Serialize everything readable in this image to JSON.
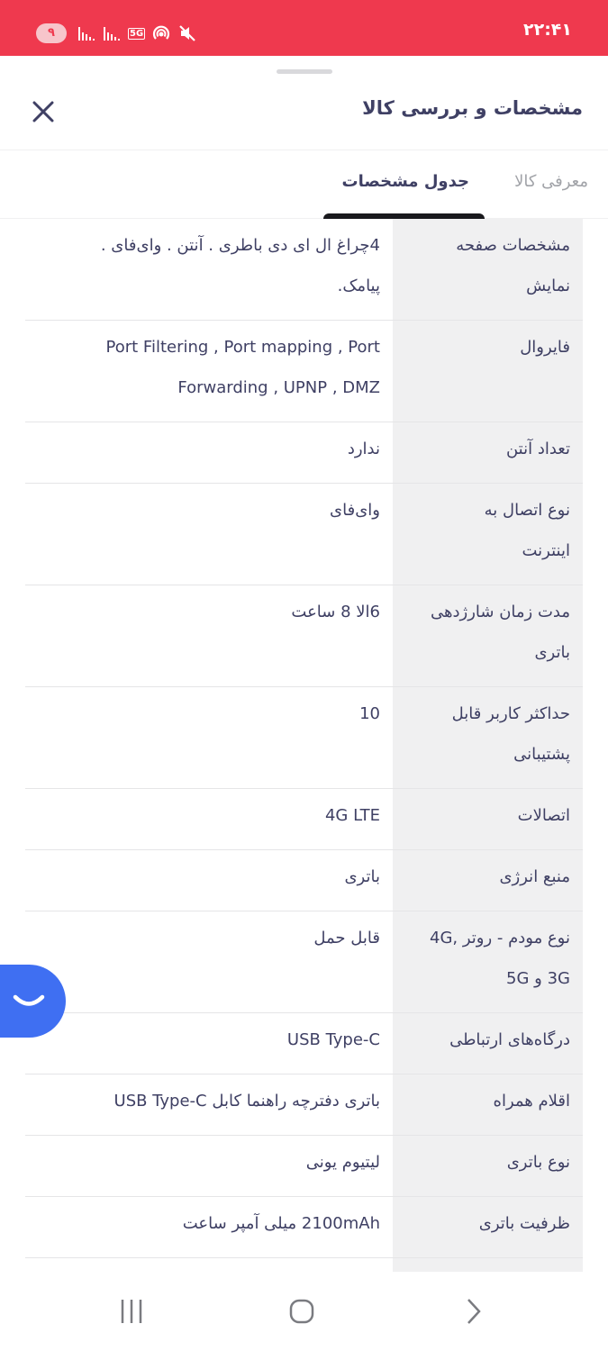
{
  "status_bar": {
    "time": "۲۲:۴۱",
    "notification_count": "۹",
    "network_label": "5G",
    "color": "#ef394e"
  },
  "sheet": {
    "title": "مشخصات و بررسی کالا",
    "close_icon": "close-icon"
  },
  "tabs": [
    {
      "label": "معرفی کالا",
      "active": false
    },
    {
      "label": "جدول مشخصات",
      "active": true
    }
  ],
  "specs": [
    {
      "key": [
        "مشخصات صفحه",
        "نمایش"
      ],
      "value": [
        "4چراغ ال ای دی باطری . آنتن . وای‌فای .",
        "پیامک."
      ]
    },
    {
      "key": [
        "فایروال"
      ],
      "value": [
        "Port Filtering , Port mapping , Port",
        "Forwarding , UPNP , DMZ"
      ],
      "ltr": true
    },
    {
      "key": [
        "تعداد آنتن"
      ],
      "value": [
        "ندارد"
      ]
    },
    {
      "key": [
        "نوع اتصال به",
        "اینترنت"
      ],
      "value": [
        "وای‌فای"
      ]
    },
    {
      "key": [
        "مدت زمان شارژدهی",
        "باتری"
      ],
      "value": [
        "6الا 8 ساعت"
      ]
    },
    {
      "key": [
        "حداکثر کاربر قابل",
        "پشتیبانی"
      ],
      "value": [
        "10"
      ]
    },
    {
      "key": [
        "اتصالات"
      ],
      "value": [
        "4G LTE"
      ]
    },
    {
      "key": [
        "منبع انرژی"
      ],
      "value": [
        "باتری"
      ]
    },
    {
      "key": [
        "نوع مودم - روتر ,4G",
        "3G و 5G"
      ],
      "value": [
        "قابل حمل"
      ]
    },
    {
      "key": [
        "درگاه‌های ارتباطی"
      ],
      "value": [
        "USB Type-C"
      ]
    },
    {
      "key": [
        "اقلام همراه"
      ],
      "value": [
        "باتری دفترچه راهنما کابل USB Type-C"
      ]
    },
    {
      "key": [
        "نوع باتری"
      ],
      "value": [
        "لیتیوم یونی"
      ]
    },
    {
      "key": [
        "ظرفیت باتری"
      ],
      "value": [
        "2100mAh میلی آمپر ساعت"
      ]
    },
    {
      "key": [
        ""
      ],
      "value": [
        ""
      ]
    }
  ],
  "chat_button": {
    "icon": "chat-smile-icon",
    "color": "#3f6ff2"
  },
  "nav_bar": {
    "recents_icon": "recents-icon",
    "home_icon": "home-icon",
    "back_icon": "back-icon"
  }
}
